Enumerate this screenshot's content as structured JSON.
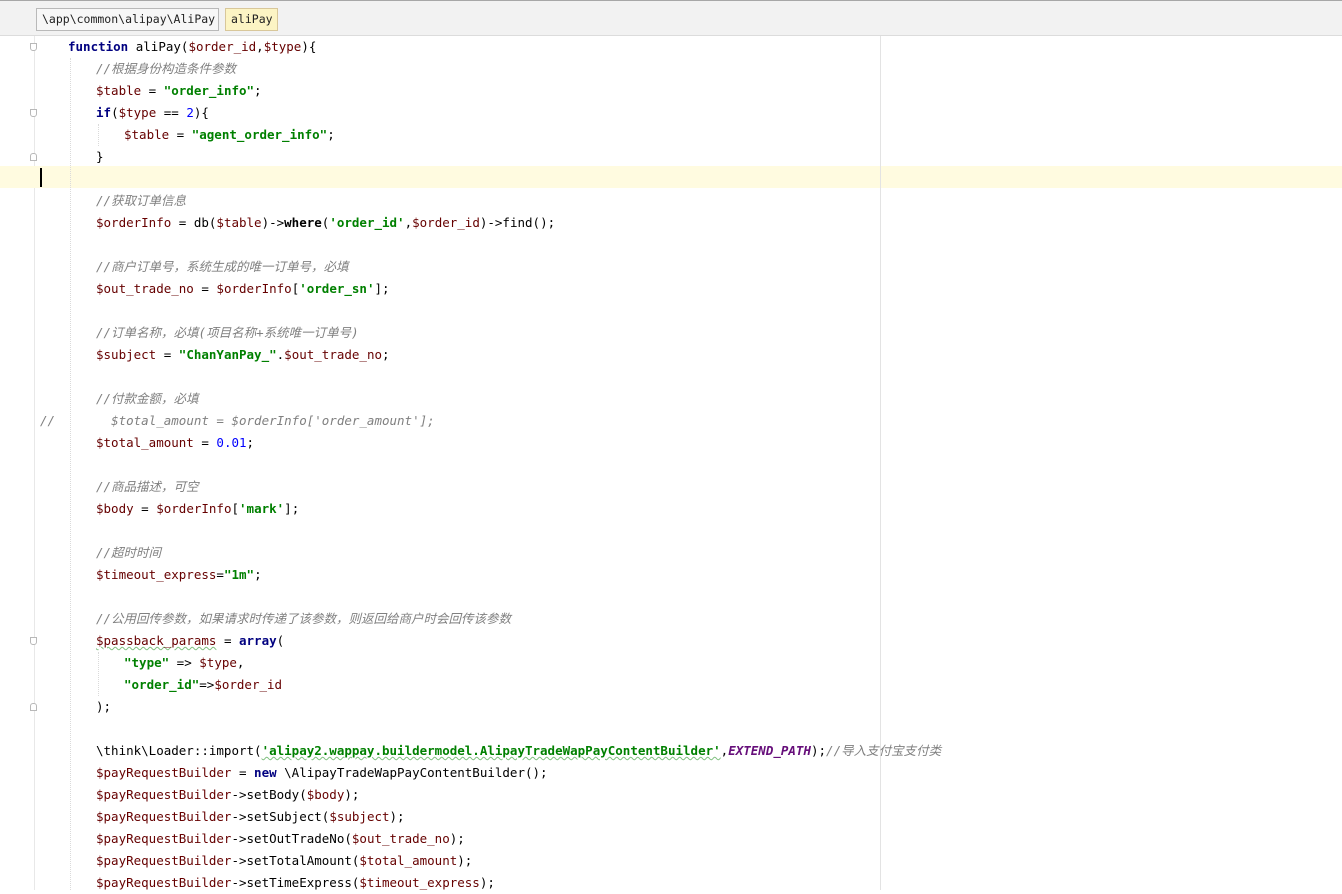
{
  "breadcrumb": {
    "path": "\\app\\common\\alipay\\AliPay",
    "function": "aliPay"
  },
  "code": {
    "l1_kw": "function",
    "l1_name": "aliPay",
    "l1_paren": "(",
    "l1_arg1": "$order_id",
    "l1_comma": ",",
    "l1_arg2": "$type",
    "l1_close": "){",
    "l2": "//根据身份构造条件参数",
    "l3_var": "$table",
    "l3_eq": " = ",
    "l3_str": "\"order_info\"",
    "l3_semi": ";",
    "l4_kw": "if",
    "l4_open": "(",
    "l4_var": "$type",
    "l4_op": " == ",
    "l4_num": "2",
    "l4_close": "){",
    "l5_var": "$table",
    "l5_eq": " = ",
    "l5_str": "\"agent_order_info\"",
    "l5_semi": ";",
    "l6": "}",
    "l8": "//获取订单信息",
    "l9_var": "$orderInfo",
    "l9_eq": " = db(",
    "l9_arg": "$table",
    "l9_arrow": ")->",
    "l9_where": "where",
    "l9_p": "(",
    "l9_str": "'order_id'",
    "l9_c": ",",
    "l9_arg2": "$order_id",
    "l9_end": ")->find();",
    "l11": "//商户订单号，系统生成的唯一订单号，必填",
    "l12_var": "$out_trade_no",
    "l12_eq": " = ",
    "l12_var2": "$orderInfo",
    "l12_b": "[",
    "l12_str": "'order_sn'",
    "l12_end": "];",
    "l14": "//订单名称，必填(项目名称+系统唯一订单号)",
    "l15_var": "$subject",
    "l15_eq": " = ",
    "l15_str": "\"ChanYanPay_\"",
    "l15_dot": ".",
    "l15_var2": "$out_trade_no",
    "l15_semi": ";",
    "l17": "//付款金额，必填",
    "l18_slash": "//",
    "l18_rest": "$total_amount = $orderInfo['order_amount'];",
    "l19_var": "$total_amount",
    "l19_eq": " = ",
    "l19_num": "0.01",
    "l19_semi": ";",
    "l21": "//商品描述，可空",
    "l22_var": "$body",
    "l22_eq": " = ",
    "l22_var2": "$orderInfo",
    "l22_b": "[",
    "l22_str": "'mark'",
    "l22_end": "];",
    "l24": "//超时时间",
    "l25_var": "$timeout_express",
    "l25_eq": "=",
    "l25_str": "\"1m\"",
    "l25_semi": ";",
    "l27": "//公用回传参数，如果请求时传递了该参数，则返回给商户时会回传该参数",
    "l28_var": "$passback_params",
    "l28_eq": " = ",
    "l28_kw": "array",
    "l28_p": "(",
    "l29_str": "\"type\"",
    "l29_arrow": " => ",
    "l29_var": "$type",
    "l29_c": ",",
    "l30_str": "\"order_id\"",
    "l30_arrow": "=>",
    "l30_var": "$order_id",
    "l31": ");",
    "l33_a": "\\think\\Loader::import(",
    "l33_str": "'alipay2.wappay.buildermodel.AlipayTradeWapPayContentBuilder'",
    "l33_c": ",",
    "l33_const": "EXTEND_PATH",
    "l33_p": ");",
    "l33_cmt": "//导入支付宝支付类",
    "l34_var": "$payRequestBuilder",
    "l34_eq": " = ",
    "l34_kw": "new",
    "l34_rest": " \\AlipayTradeWapPayContentBuilder();",
    "l35_var": "$payRequestBuilder",
    "l35_m": "->setBody(",
    "l35_arg": "$body",
    "l35_end": ");",
    "l36_var": "$payRequestBuilder",
    "l36_m": "->setSubject(",
    "l36_arg": "$subject",
    "l36_end": ");",
    "l37_var": "$payRequestBuilder",
    "l37_m": "->setOutTradeNo(",
    "l37_arg": "$out_trade_no",
    "l37_end": ");",
    "l38_var": "$payRequestBuilder",
    "l38_m": "->setTotalAmount(",
    "l38_arg": "$total_amount",
    "l38_end": ");",
    "l39_var": "$payRequestBuilder",
    "l39_m": "->setTimeExpress(",
    "l39_arg": "$timeout_express",
    "l39_end": ");"
  }
}
